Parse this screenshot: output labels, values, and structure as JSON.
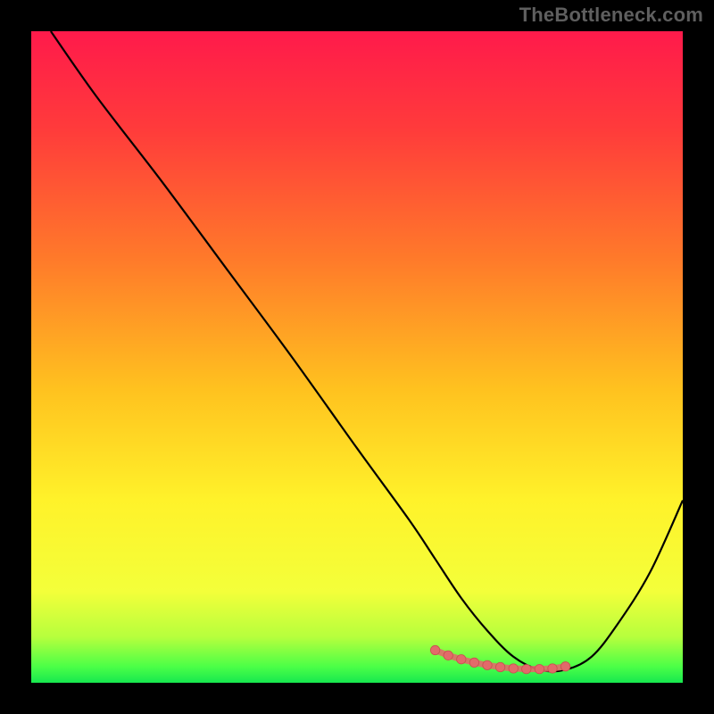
{
  "attribution": "TheBottleneck.com",
  "colors": {
    "background": "#000000",
    "attribution": "#5f5f5f",
    "gradient_stops": [
      {
        "offset": 0.0,
        "color": "#ff1a4b"
      },
      {
        "offset": 0.15,
        "color": "#ff3b3b"
      },
      {
        "offset": 0.35,
        "color": "#ff7a2a"
      },
      {
        "offset": 0.55,
        "color": "#ffc21f"
      },
      {
        "offset": 0.72,
        "color": "#fff22a"
      },
      {
        "offset": 0.86,
        "color": "#f3ff3a"
      },
      {
        "offset": 0.93,
        "color": "#b6ff3d"
      },
      {
        "offset": 0.975,
        "color": "#4cff47"
      },
      {
        "offset": 1.0,
        "color": "#17e84f"
      }
    ],
    "curve": "#000000",
    "marker_fill": "#e26a6a",
    "marker_stroke": "#c94f4f"
  },
  "chart_data": {
    "type": "line",
    "title": "",
    "xlabel": "",
    "ylabel": "",
    "xlim": [
      0,
      100
    ],
    "ylim": [
      0,
      100
    ],
    "series": [
      {
        "name": "bottleneck-curve",
        "x": [
          3,
          10,
          20,
          30,
          40,
          50,
          58,
          62,
          66,
          70,
          74,
          78,
          82,
          86,
          90,
          95,
          100
        ],
        "y": [
          100,
          90,
          77,
          63.5,
          50,
          36,
          25,
          19,
          13,
          8,
          4,
          2,
          2,
          4,
          9,
          17,
          28
        ]
      }
    ],
    "markers": {
      "name": "optimal-range",
      "x": [
        62,
        64,
        66,
        68,
        70,
        72,
        74,
        76,
        78,
        80,
        82
      ],
      "y": [
        5.0,
        4.2,
        3.6,
        3.1,
        2.7,
        2.4,
        2.2,
        2.1,
        2.1,
        2.2,
        2.5
      ]
    }
  }
}
